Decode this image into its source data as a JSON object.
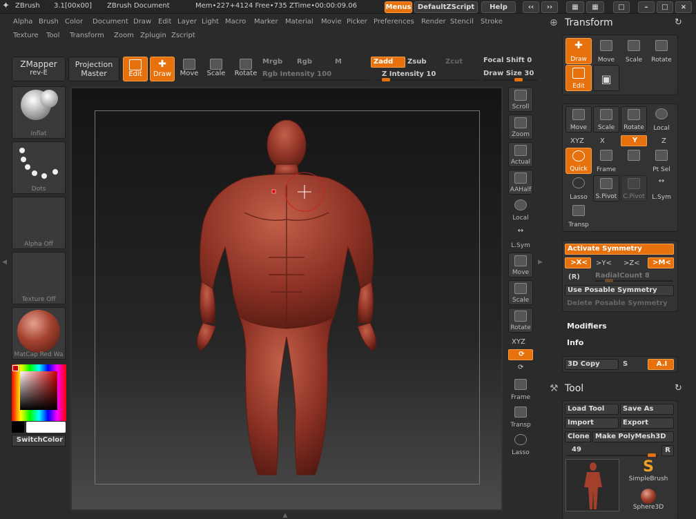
{
  "titlebar": {
    "app": "ZBrush",
    "version": "3.1[00x00]",
    "document": "ZBrush Document",
    "mem": "Mem•227+4124 Free•735 ZTime•00:00:09.06",
    "menus": "Menus",
    "zscript": "DefaultZScript",
    "help": "Help"
  },
  "menubar": {
    "row1": [
      "Alpha",
      "Brush",
      "Color",
      "Document",
      "Draw",
      "Edit",
      "Layer",
      "Light",
      "Macro",
      "Marker",
      "Material",
      "Movie",
      "Picker",
      "Preferences",
      "Render",
      "Stencil",
      "Stroke"
    ],
    "row2": [
      "Texture",
      "Tool",
      "Transform",
      "Zoom",
      "Zplugin",
      "Zscript"
    ]
  },
  "toolbar": {
    "zmapper": "ZMapper",
    "zmapper_sub": "rev-E",
    "projection": "Projection",
    "projection_sub": "Master",
    "edit": "Edit",
    "draw": "Draw",
    "move": "Move",
    "scale": "Scale",
    "rotate": "Rotate",
    "mrgb": "Mrgb",
    "rgb": "Rgb",
    "m": "M",
    "zadd": "Zadd",
    "zsub": "Zsub",
    "zcut": "Zcut",
    "rgb_intensity": "Rgb Intensity 100",
    "z_intensity": "Z Intensity 10",
    "focal_shift": "Focal Shift 0",
    "draw_size": "Draw Size 30"
  },
  "left": {
    "brush": "Inflat",
    "stroke": "Dots",
    "alpha": "Alpha Off",
    "texture": "Texture Off",
    "material": "MatCap Red Wa",
    "switch_color": "SwitchColor"
  },
  "viewtools": [
    "Scroll",
    "Zoom",
    "Actual",
    "AAHalf",
    "Local",
    "L.Sym",
    "Move",
    "Scale",
    "Rotate",
    "XYZ",
    "",
    "",
    "Frame",
    "Transp",
    "Lasso"
  ],
  "transform": {
    "title": "Transform",
    "top": [
      "Draw",
      "Move",
      "Scale",
      "Rotate"
    ],
    "edit": "Edit",
    "nav": [
      "Move",
      "Scale",
      "Rotate",
      "Local"
    ],
    "axes": [
      "XYZ",
      "X",
      "Y",
      "Z"
    ],
    "row3": [
      "Quick",
      "Frame",
      "",
      "Pt Sel"
    ],
    "row4": [
      "Lasso",
      "S.Pivot",
      "C.Pivot",
      "L.Sym"
    ],
    "transp": "Transp"
  },
  "symmetry": {
    "activate": "Activate Symmetry",
    "axes": [
      ">X<",
      ">Y<",
      ">Z<",
      ">M<"
    ],
    "r": "(R)",
    "radial": "RadialCount 8",
    "posable": "Use Posable Symmetry",
    "delete_posable": "Delete Posable Symmetry"
  },
  "modifiers": "Modifiers",
  "info": "Info",
  "copy3d": {
    "label": "3D Copy",
    "s": "S",
    "ai": "A.I"
  },
  "tool": {
    "title": "Tool",
    "load": "Load Tool",
    "save": "Save As",
    "import": "Import",
    "export": "Export",
    "clone": "Clone",
    "make_poly": "Make PolyMesh3D",
    "count": "49",
    "r": "R",
    "simplebrush": "SimpleBrush",
    "sphere3d": "Sphere3D"
  },
  "colors": {
    "accent": "#e7720d",
    "bg": "#2b2b2b",
    "skin": "#8e3225"
  }
}
